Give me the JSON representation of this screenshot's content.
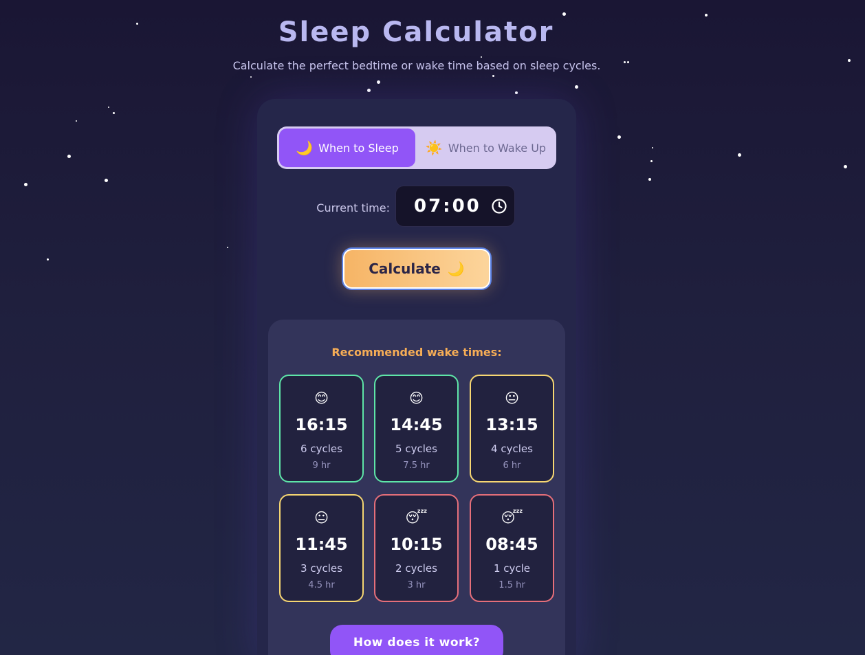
{
  "app": {
    "title": "Sleep Calculator",
    "subtitle": "Calculate the perfect bedtime or wake time based on sleep cycles."
  },
  "mode_toggle": {
    "sleep_icon": "🌙",
    "sleep_label": "When to Sleep",
    "wake_icon": "☀️",
    "wake_label": "When to Wake Up",
    "active": "sleep"
  },
  "time_input": {
    "label": "Current time:",
    "value": "07:00",
    "icon": "clock-icon"
  },
  "calculate": {
    "label": "Calculate",
    "icon": "🌙"
  },
  "results": {
    "heading": "Recommended wake times:",
    "items": [
      {
        "emoji": "😊",
        "time": "16:15",
        "cycles": "6 cycles",
        "hours": "9 hr",
        "quality": "good"
      },
      {
        "emoji": "😊",
        "time": "14:45",
        "cycles": "5 cycles",
        "hours": "7.5 hr",
        "quality": "good"
      },
      {
        "emoji": "😐",
        "time": "13:15",
        "cycles": "4 cycles",
        "hours": "6 hr",
        "quality": "ok"
      },
      {
        "emoji": "😐",
        "time": "11:45",
        "cycles": "3 cycles",
        "hours": "4.5 hr",
        "quality": "ok"
      },
      {
        "emoji": "😴",
        "time": "10:15",
        "cycles": "2 cycles",
        "hours": "3 hr",
        "quality": "poor"
      },
      {
        "emoji": "😴",
        "time": "08:45",
        "cycles": "1 cycle",
        "hours": "1.5 hr",
        "quality": "poor"
      }
    ]
  },
  "help_button": {
    "label": "How does it work?"
  },
  "colors": {
    "accent_purple": "#9155f7",
    "accent_orange": "#f6ad56",
    "good": "#5ee6a8",
    "ok": "#f7d772",
    "poor": "#e66f7a"
  }
}
